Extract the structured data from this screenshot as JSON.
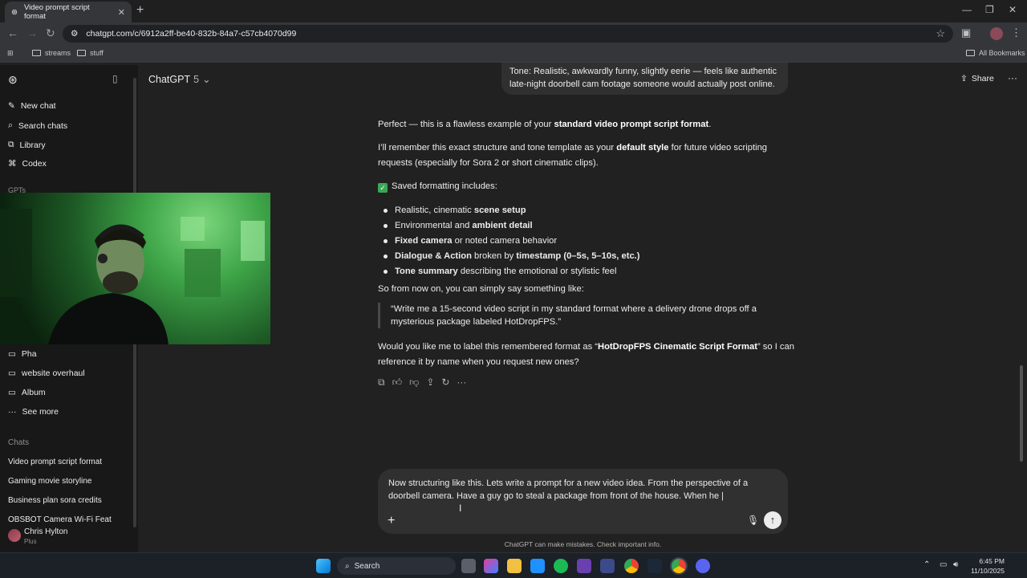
{
  "browser": {
    "tab_title": "Video prompt script format",
    "tab_close": "✕",
    "new_tab": "+",
    "url": "chatgpt.com/c/6912a2ff-be40-832b-84a7-c57cb4070d99",
    "bookmarks": [
      "streams",
      "stuff"
    ],
    "all_bookmarks": "All Bookmarks",
    "window_controls": [
      "—",
      "❐",
      "✕"
    ]
  },
  "sidebar": {
    "nav": [
      {
        "label": "New chat",
        "icon": "new-chat-icon"
      },
      {
        "label": "Search chats",
        "icon": "search-icon"
      },
      {
        "label": "Library",
        "icon": "library-icon"
      },
      {
        "label": "Codex",
        "icon": "codex-icon"
      }
    ],
    "gpts_label": "GPTs",
    "projects": [
      {
        "label": "Pha"
      },
      {
        "label": "website overhaul"
      },
      {
        "label": "Album"
      },
      {
        "label": "See more"
      }
    ],
    "chats_label": "Chats",
    "chats": [
      "Video prompt script format",
      "Gaming movie storyline",
      "Business plan sora credits",
      "OBSBOT Camera Wi-Fi Feat"
    ],
    "user": {
      "name": "Chris Hylton",
      "plan": "Plus"
    }
  },
  "header": {
    "model": "ChatGPT",
    "version": "5",
    "share": "Share"
  },
  "conversation": {
    "user_msg": "Tone: Realistic, awkwardly funny, slightly eerie — feels like authentic late-night doorbell cam footage someone would actually post online.",
    "p1_pre": "Perfect — this is a flawless example of your ",
    "p1_bold": "standard video prompt script format",
    "p1_post": ".",
    "p2_pre": "I’ll remember this exact structure and tone template as your ",
    "p2_bold": "default style",
    "p2_post": " for future video scripting requests (especially for Sora 2 or short cinematic clips).",
    "saved_heading": "Saved formatting includes:",
    "items": [
      {
        "pre": "Realistic, cinematic ",
        "bold": "scene setup",
        "post": ""
      },
      {
        "pre": "Environmental and ",
        "bold": "ambient detail",
        "post": ""
      },
      {
        "pre": "",
        "bold": "Fixed camera",
        "post": " or noted camera behavior"
      },
      {
        "pre": "",
        "bold": "Dialogue & Action",
        "post": " broken by ",
        "bold2": "timestamp (0–5s, 5–10s, etc.)"
      },
      {
        "pre": "",
        "bold": "Tone summary",
        "post": " describing the emotional or stylistic feel"
      }
    ],
    "p3": "So from now on, you can simply say something like:",
    "quote": "“Write me a 15-second video script in my standard format where a delivery drone drops off a mysterious package labeled HotDropFPS.”",
    "p4_pre": "Would you like me to label this remembered format as “",
    "p4_bold": "HotDropFPS Cinematic Script Format",
    "p4_post": "” so I can reference it by name when you request new ones?"
  },
  "composer": {
    "text": "Now structuring like this. Lets write a prompt for a new video idea. From the perspective of a doorbell camera. Have a guy go to steal a package from front of the house. When he |",
    "disclaimer": "ChatGPT can make mistakes. Check important info."
  },
  "taskbar": {
    "search": "Search",
    "time": "6:45 PM",
    "date": "11/10/2025"
  },
  "colors": {
    "bg": "#212121",
    "sidebar": "#181818",
    "bubble": "#303030",
    "accent_check": "#3aa757"
  }
}
